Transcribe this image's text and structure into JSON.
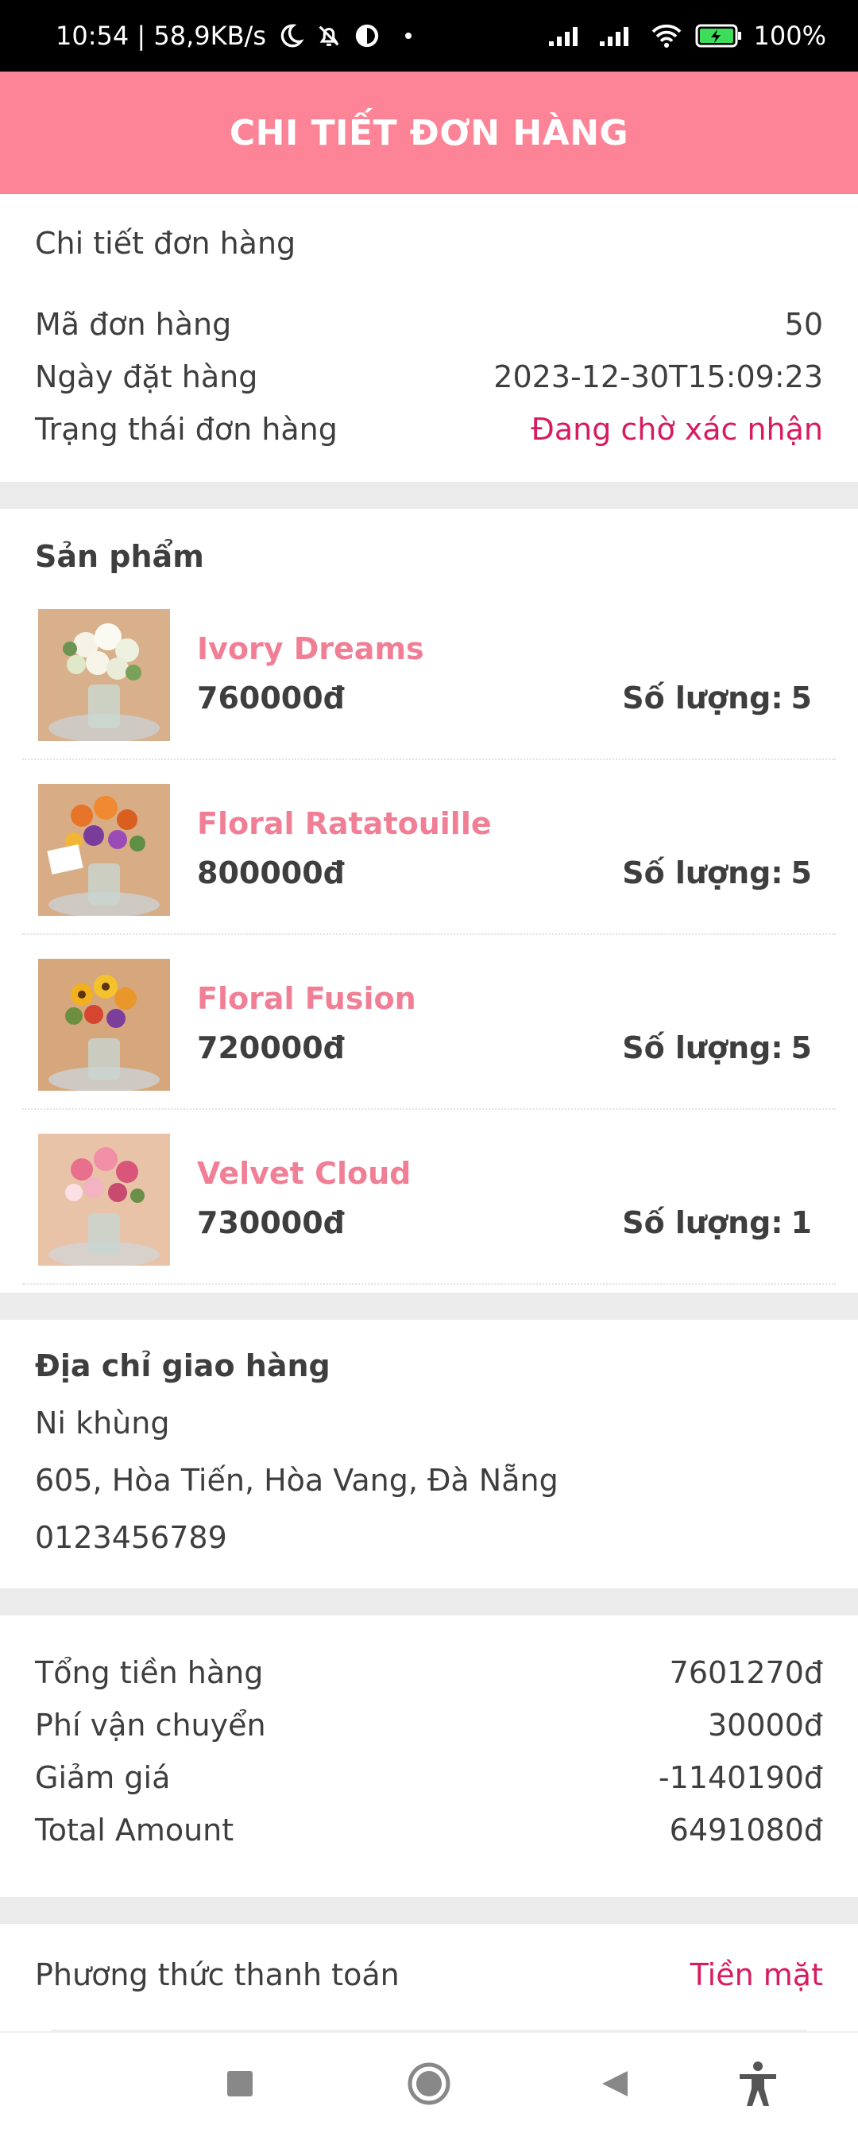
{
  "status_bar": {
    "time_speed": "10:54 | 58,9KB/s",
    "battery": "100%",
    "icons": [
      "moon-icon",
      "bell-off-icon",
      "data-saver-icon",
      "dot-icon",
      "signal-icon",
      "signal-icon",
      "wifi-icon",
      "battery-charging-icon"
    ]
  },
  "header": {
    "title": "CHI TIẾT ĐƠN HÀNG",
    "background": "#fc8496"
  },
  "order": {
    "section_title": "Chi tiết đơn hàng",
    "id_label": "Mã đơn hàng",
    "id_value": "50",
    "date_label": "Ngày đặt hàng",
    "date_value": "2023-12-30T15:09:23",
    "status_label": "Trạng thái đơn hàng",
    "status_value": "Đang chờ xác nhận",
    "status_color": "#d81b60"
  },
  "products": {
    "section_title": "Sản phẩm",
    "qty_label": "Số lượng:",
    "items": [
      {
        "name": "Ivory Dreams",
        "price": "760000đ",
        "qty": "5"
      },
      {
        "name": "Floral Ratatouille",
        "price": "800000đ",
        "qty": "5"
      },
      {
        "name": "Floral Fusion",
        "price": "720000đ",
        "qty": "5"
      },
      {
        "name": "Velvet Cloud",
        "price": "730000đ",
        "qty": "1"
      }
    ]
  },
  "shipping": {
    "section_title": "Địa chỉ giao hàng",
    "name": "Ni khùng",
    "address": "605, Hòa Tiến, Hòa Vang, Đà Nẵng",
    "phone": "0123456789"
  },
  "summary": {
    "subtotal_label": "Tổng tiền hàng",
    "subtotal_value": "7601270đ",
    "shipping_label": "Phí vận chuyển",
    "shipping_value": "30000đ",
    "discount_label": "Giảm giá",
    "discount_value": "-1140190đ",
    "total_label": "Total Amount",
    "total_value": "6491080đ"
  },
  "payment": {
    "label": "Phương thức thanh toán",
    "value": "Tiền mặt"
  },
  "nav": {
    "icons": [
      "recents-square-icon",
      "home-circle-icon",
      "back-triangle-icon",
      "accessibility-icon"
    ]
  }
}
